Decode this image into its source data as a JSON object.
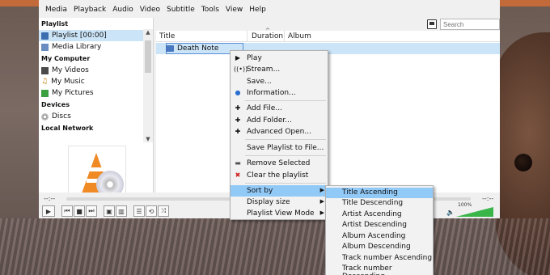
{
  "menubar": [
    "Media",
    "Playback",
    "Audio",
    "Video",
    "Subtitle",
    "Tools",
    "View",
    "Help"
  ],
  "sidebar": {
    "sections": [
      {
        "title": "Playlist",
        "items": [
          {
            "label": "Playlist [00:00]",
            "icon": "playlist-icon",
            "selected": true
          },
          {
            "label": "Media Library",
            "icon": "media-library-icon"
          }
        ]
      },
      {
        "title": "My Computer",
        "items": [
          {
            "label": "My Videos",
            "icon": "video-icon"
          },
          {
            "label": "My Music",
            "icon": "music-icon"
          },
          {
            "label": "My Pictures",
            "icon": "pictures-icon"
          }
        ]
      },
      {
        "title": "Devices",
        "items": [
          {
            "label": "Discs",
            "icon": "disc-icon"
          }
        ]
      },
      {
        "title": "Local Network",
        "items": []
      }
    ]
  },
  "search": {
    "placeholder": "Search"
  },
  "playlist": {
    "columns": [
      "Title",
      "Duration",
      "Album"
    ],
    "rows": [
      {
        "title": "Death Note"
      }
    ]
  },
  "controls": {
    "time_left": "--:--",
    "time_right": "--:--",
    "volume": "100%"
  },
  "context_menu": {
    "items": [
      "Play",
      "Stream...",
      "Save...",
      "Information...",
      "Add File...",
      "Add Folder...",
      "Advanced Open...",
      "Save Playlist to File...",
      "Remove Selected",
      "Clear the playlist",
      "Sort by",
      "Display size",
      "Playlist View Mode"
    ],
    "highlighted": "Sort by"
  },
  "sort_submenu": {
    "items": [
      "Title Ascending",
      "Title Descending",
      "Artist Ascending",
      "Artist Descending",
      "Album Ascending",
      "Album Descending",
      "Track number Ascending",
      "Track number Descending"
    ],
    "highlighted": "Title Ascending"
  }
}
